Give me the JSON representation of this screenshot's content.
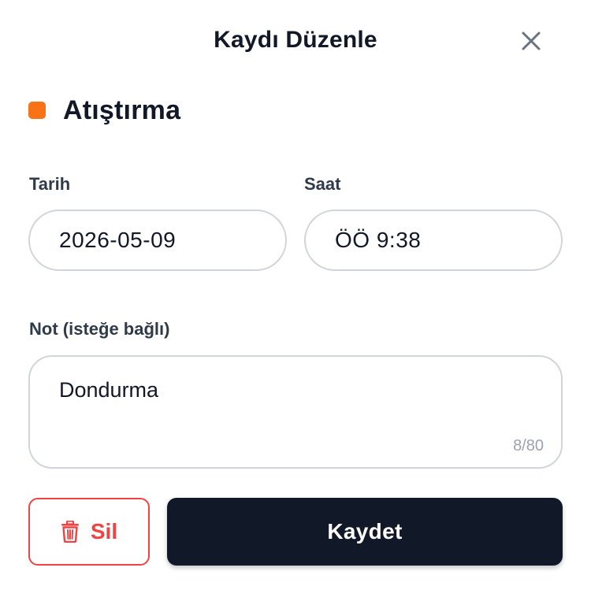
{
  "dialog": {
    "title": "Kaydı Düzenle",
    "close_icon": "close-icon"
  },
  "category": {
    "label": "Atıştırma",
    "color": "#f97316"
  },
  "date_field": {
    "label": "Tarih",
    "value": "2026-05-09"
  },
  "time_field": {
    "label": "Saat",
    "value": "ÖÖ 9:38"
  },
  "note_field": {
    "label": "Not (isteğe bağlı)",
    "value": "Dondurma",
    "counter": "8/80"
  },
  "actions": {
    "delete_label": "Sil",
    "delete_icon": "trash-icon",
    "delete_color": "#ef4444",
    "save_label": "Kaydet",
    "save_color": "#111827"
  }
}
